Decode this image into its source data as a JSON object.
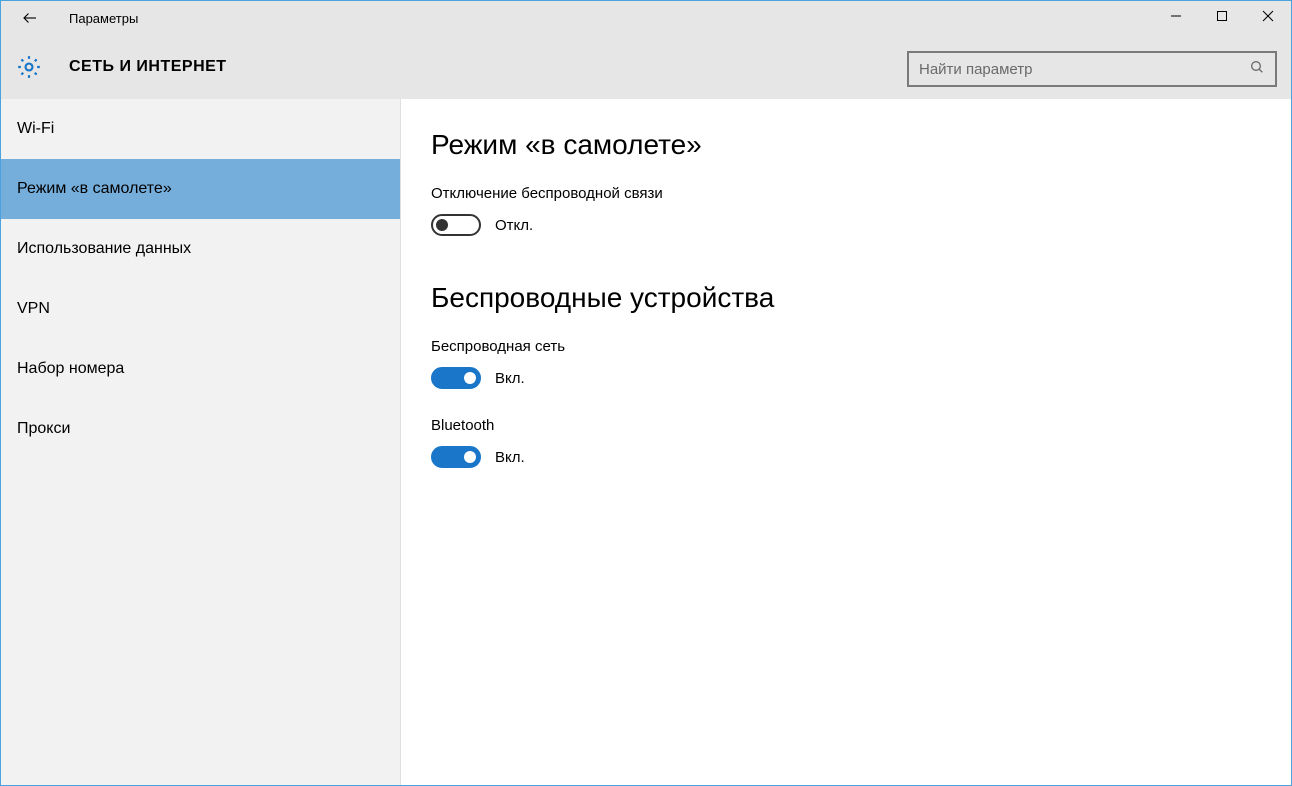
{
  "window": {
    "title": "Параметры"
  },
  "header": {
    "category": "СЕТЬ И ИНТЕРНЕТ",
    "search_placeholder": "Найти параметр"
  },
  "sidebar": {
    "items": [
      {
        "label": "Wi-Fi",
        "selected": false
      },
      {
        "label": "Режим «в самолете»",
        "selected": true
      },
      {
        "label": "Использование данных",
        "selected": false
      },
      {
        "label": "VPN",
        "selected": false
      },
      {
        "label": "Набор номера",
        "selected": false
      },
      {
        "label": "Прокси",
        "selected": false
      }
    ]
  },
  "main": {
    "section1": {
      "title": "Режим «в самолете»",
      "subtitle": "Отключение беспроводной связи",
      "toggle_state_label": "Откл.",
      "toggle_on": false
    },
    "section2": {
      "title": "Беспроводные устройства",
      "item1": {
        "label": "Беспроводная сеть",
        "state_label": "Вкл.",
        "toggle_on": true
      },
      "item2": {
        "label": "Bluetooth",
        "state_label": "Вкл.",
        "toggle_on": true
      }
    }
  }
}
